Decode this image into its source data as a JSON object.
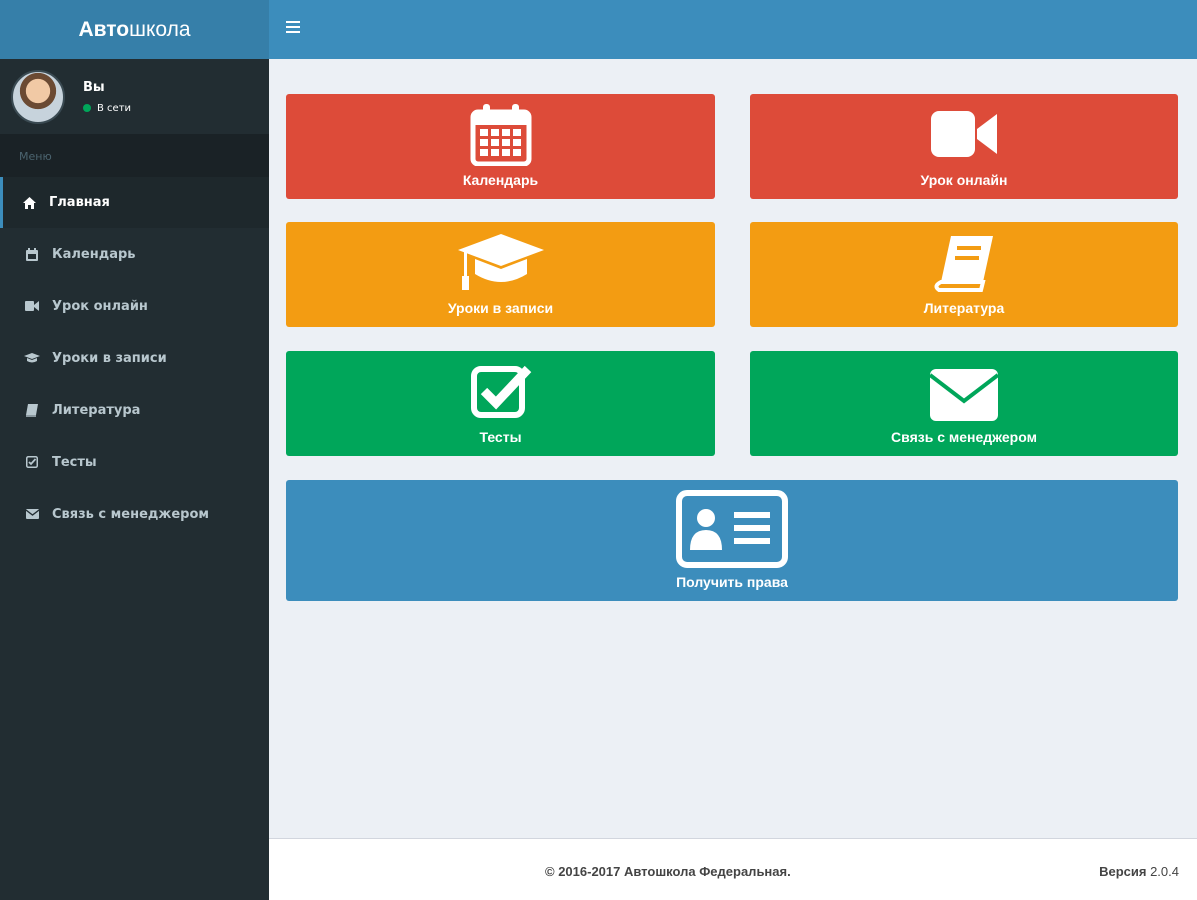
{
  "app": {
    "logo_bold": "Авто",
    "logo_rest": "школа"
  },
  "user": {
    "name": "Вы",
    "status": "В сети"
  },
  "sidebar": {
    "header": "Меню",
    "items": [
      {
        "label": "Главная",
        "icon": "home-icon",
        "active": true
      },
      {
        "label": "Календарь",
        "icon": "calendar-icon"
      },
      {
        "label": "Урок онлайн",
        "icon": "video-camera-icon"
      },
      {
        "label": "Уроки в записи",
        "icon": "graduation-cap-icon"
      },
      {
        "label": "Литература",
        "icon": "book-icon"
      },
      {
        "label": "Тесты",
        "icon": "check-square-icon"
      },
      {
        "label": "Связь с менеджером",
        "icon": "envelope-icon"
      }
    ]
  },
  "tiles": {
    "calendar": {
      "label": "Календарь",
      "icon": "calendar-icon",
      "color": "#dd4b39"
    },
    "online": {
      "label": "Урок онлайн",
      "icon": "video-camera-icon",
      "color": "#dd4b39"
    },
    "recorded": {
      "label": "Уроки в записи",
      "icon": "graduation-cap-icon",
      "color": "#f39c12"
    },
    "literature": {
      "label": "Литература",
      "icon": "book-icon",
      "color": "#f39c12"
    },
    "tests": {
      "label": "Тесты",
      "icon": "check-square-icon",
      "color": "#00a65a"
    },
    "manager": {
      "label": "Связь с менеджером",
      "icon": "envelope-icon",
      "color": "#00a65a"
    },
    "license": {
      "label": "Получить права",
      "icon": "id-card-icon",
      "color": "#3c8dbc"
    }
  },
  "footer": {
    "copyright": "© 2016-2017 Автошкола Федеральная.",
    "version_label": "Версия",
    "version_number": "2.0.4"
  }
}
